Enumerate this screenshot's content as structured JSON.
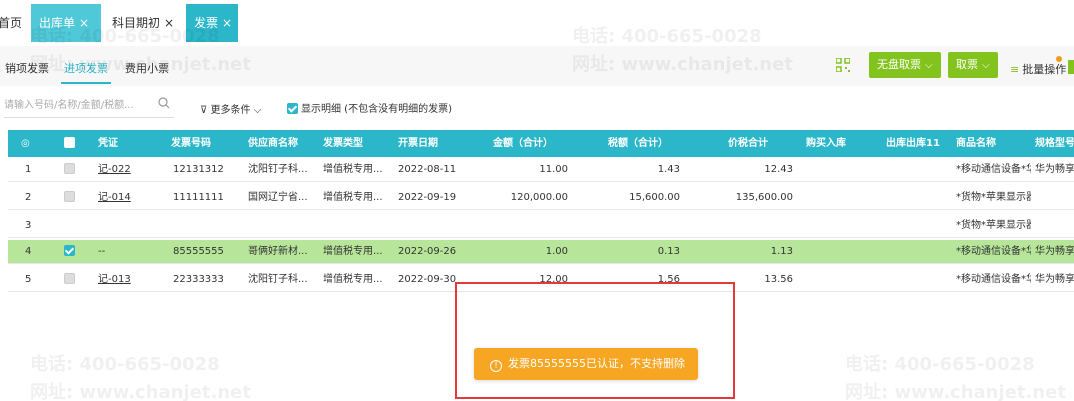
{
  "tabs": [
    {
      "label": "首页"
    },
    {
      "label": "出库单",
      "close": "×"
    },
    {
      "label": "科目期初",
      "close": "×"
    },
    {
      "label": "发票",
      "close": "×"
    }
  ],
  "subtabs": [
    "销项发票",
    "进项发票",
    "费用小票"
  ],
  "toolbar": {
    "no_disk_label": "无盘取票",
    "fetch_label": "取票",
    "batch_label": "批量操作",
    "accent": "#82c31e"
  },
  "search": {
    "placeholder": "请输入号码/名称/金额/税额..."
  },
  "filters": {
    "more": "更多条件",
    "show_detail": "显示明细 (不包含没有明细的发票)"
  },
  "table": {
    "columns": [
      "凭证",
      "发票号码",
      "供应商名称",
      "发票类型",
      "开票日期",
      "金额（合计）",
      "税额（合计）",
      "价税合计",
      "购买入库",
      "出库出库11",
      "商品名称",
      "规格型号"
    ],
    "rows": [
      {
        "idx": "1",
        "voucher": "记-022",
        "number": "12131312",
        "supplier": "沈阳钉子科...",
        "type": "增值税专用...",
        "date": "2022-08-11",
        "amount": "11.00",
        "tax": "1.43",
        "total": "12.43",
        "goods": "*移动通信设备*华为畅享",
        "model": "华为畅享"
      },
      {
        "idx": "2",
        "voucher": "记-014",
        "number": "11111111",
        "supplier": "国网辽宁省...",
        "type": "增值税专用...",
        "date": "2022-09-19",
        "amount": "120,000.00",
        "tax": "15,600.00",
        "total": "135,600.00",
        "goods": "*货物*苹果显示器",
        "model": ""
      },
      {
        "idx": "3",
        "voucher": "",
        "number": "",
        "supplier": "",
        "type": "",
        "date": "",
        "amount": "",
        "tax": "",
        "total": "",
        "goods": "*货物*苹果显示器",
        "model": ""
      },
      {
        "idx": "4",
        "voucher": "--",
        "number": "85555555",
        "supplier": "哥俩好新材...",
        "type": "增值税专用...",
        "date": "2022-09-26",
        "amount": "1.00",
        "tax": "0.13",
        "total": "1.13",
        "goods": "*移动通信设备*华为畅享",
        "model": "华为畅享"
      },
      {
        "idx": "5",
        "voucher": "记-013",
        "number": "22333333",
        "supplier": "沈阳钉子科...",
        "type": "增值税专用...",
        "date": "2022-09-30",
        "amount": "12.00",
        "tax": "1.56",
        "total": "13.56",
        "goods": "*移动通信设备*华为畅享",
        "model": "华为畅享"
      }
    ]
  },
  "toast": {
    "message": "发票85555555已认证，不支持删除"
  },
  "watermark": {
    "phone": "电话: 400-665-0028",
    "site": "网址: www.chanjet.net"
  }
}
